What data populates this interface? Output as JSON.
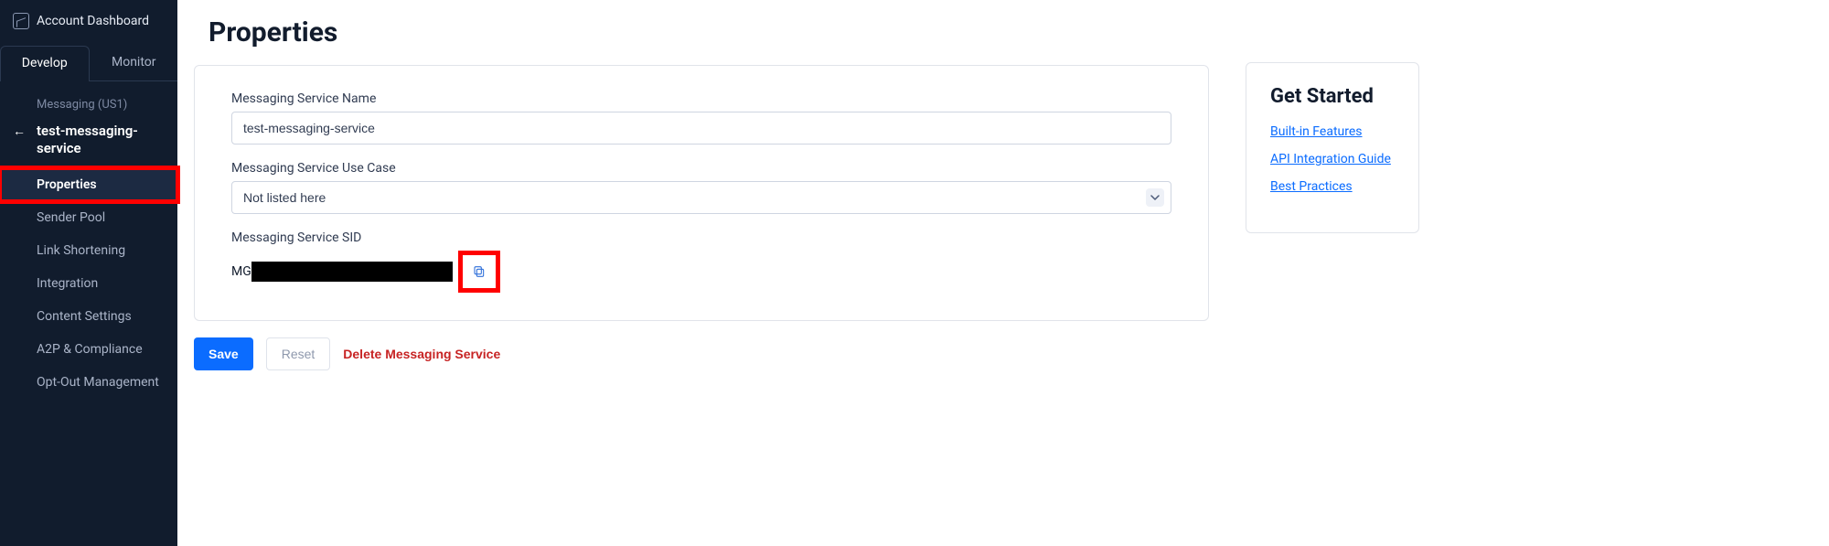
{
  "sidebar": {
    "account_dash_label": "Account Dashboard",
    "tabs": [
      {
        "label": "Develop",
        "active": true
      },
      {
        "label": "Monitor",
        "active": false
      }
    ],
    "section_label": "Messaging (US1)",
    "current_service": "test-messaging-service",
    "nav": [
      {
        "label": "Properties",
        "active": true,
        "highlight": true
      },
      {
        "label": "Sender Pool"
      },
      {
        "label": "Link Shortening"
      },
      {
        "label": "Integration"
      },
      {
        "label": "Content Settings"
      },
      {
        "label": "A2P & Compliance"
      },
      {
        "label": "Opt-Out Management"
      }
    ]
  },
  "page": {
    "title": "Properties",
    "fields": {
      "name_label": "Messaging Service Name",
      "name_value": "test-messaging-service",
      "usecase_label": "Messaging Service Use Case",
      "usecase_value": "Not listed here",
      "sid_label": "Messaging Service SID",
      "sid_prefix": "MG"
    },
    "actions": {
      "save": "Save",
      "reset": "Reset",
      "delete": "Delete Messaging Service"
    }
  },
  "right": {
    "title": "Get Started",
    "links": [
      "Built-in Features",
      "API Integration Guide",
      "Best Practices"
    ]
  }
}
